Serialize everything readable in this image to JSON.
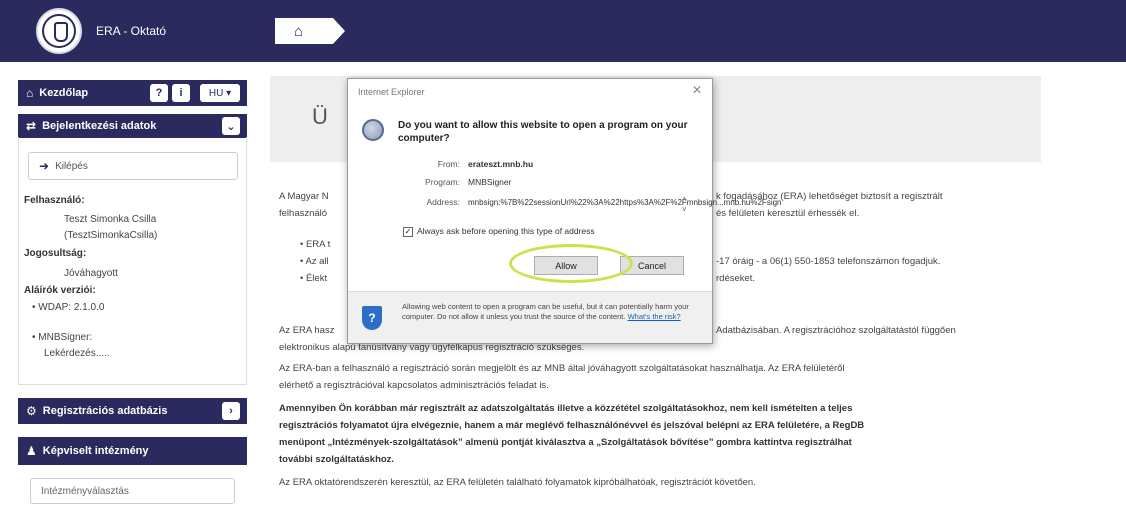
{
  "header": {
    "app_title": "ERA - Oktató",
    "home_icon": "home-icon"
  },
  "sidebar": {
    "home_label": "Kezdőlap",
    "help_button": "?",
    "info_button": "i",
    "lang_label": "HU ▾",
    "login_data_label": "Bejelentkezési adatok",
    "logout_label": "Kilépés",
    "user_heading": "Felhasználó:",
    "user_name": "Teszt Simonka Csilla",
    "user_login": "(TesztSimonkaCsilla)",
    "rights_heading": "Jogosultság:",
    "rights_value": "Jóváhagyott",
    "signer_heading": "Aláírók verziói:",
    "signer_wdap": "• WDAP: 2.1.0.0",
    "signer_mnb_1": "• MNBSigner:",
    "signer_mnb_2": "Lekérdezés.....",
    "registry_label": "Regisztrációs adatbázis",
    "institution_label": "Képviselt intézmény",
    "institution_select": "Intézményválasztás"
  },
  "main": {
    "panel_letter": "Ü",
    "p1_left": "A Magyar N",
    "p1_right": "k fogadásához (ERA) lehetőséget biztosít a regisztrált",
    "p1b_left": "felhasználó",
    "p1b_right": "és felületen keresztül érhessék el.",
    "b1": "• ERA t",
    "b2_left": "• Az all",
    "b2_right": "-17 óráig - a 06(1) 550-1853 telefonszámon fogadjuk.",
    "b3_left": "• Élekt",
    "b3_right": "rdéseket.",
    "p2_left": "Az ERA hasz",
    "p2_right": "Adatbázisában. A regisztrációhoz szolgáltatástól függően",
    "p2b": "elektronikus alapú tanúsítvány vagy ügyfélkapus regisztráció szükséges.",
    "p3a": "Az ERA-ban a felhasználó a regisztráció során megjelölt és az MNB által jóváhagyott szolgáltatásokat használhatja. Az ERA felületéről",
    "p3b": "elérhető a regisztrációval kapcsolatos adminisztrációs feladat is.",
    "p4a": "Amennyiben Ön korábban már regisztrált az adatszolgáltatás illetve a közzététel szolgáltatásokhoz, nem kell ismételten a teljes",
    "p4b": "regisztrációs folyamatot újra elvégeznie, hanem a már meglévő felhasználónévvel és jelszóval belépni az ERA felületére, a RegDB",
    "p4c": "menüpont „Intézmények-szolgáltatások” almenü pontját kiválasztva a „Szolgáltatások bővítése” gombra kattintva regisztrálhat",
    "p4d": "további szolgáltatáskhoz.",
    "p5": "Az ERA oktatórendszerén keresztül, az ERA felületén található folyamatok kipróbálhatóak, regisztrációt követően."
  },
  "dialog": {
    "title": "Internet Explorer",
    "close": "✕",
    "question": "Do you want to allow this website to open a program on your computer?",
    "from_label": "From:",
    "from_value": "erateszt.mnb.hu",
    "program_label": "Program:",
    "program_value": "MNBSigner",
    "address_label": "Address:",
    "address_value": "mnbsign:%7B%22sessionUrl%22%3A%22https%3A%2F%2Fmnbsign...mnb.hu%2Fsign",
    "checkbox_label": "Always ask before opening this type of address",
    "checkbox_checked": "✓",
    "allow_label": "Allow",
    "cancel_label": "Cancel",
    "footer_text": "Allowing web content to open a program can be useful, but it can potentially harm your computer. Do not allow it unless you trust the source of the content.",
    "footer_link": "What's the risk?"
  }
}
